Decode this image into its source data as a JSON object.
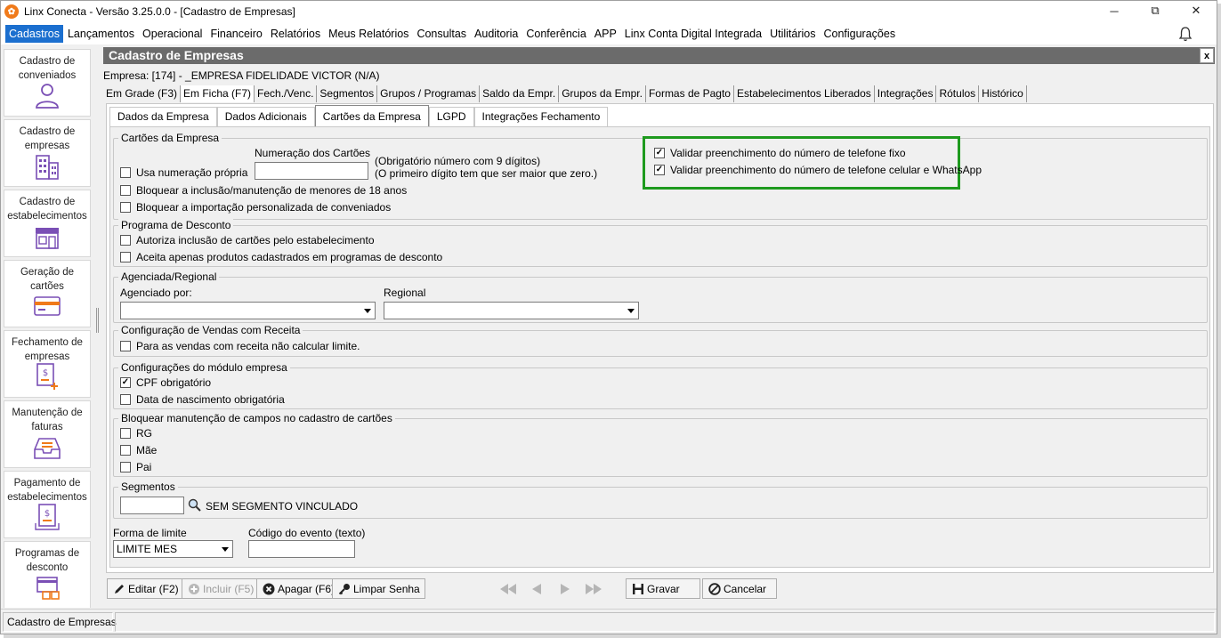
{
  "window": {
    "title": "Linx Conecta - Versão 3.25.0.0 - [Cadastro de Empresas]",
    "minimize": "─",
    "maximize": "⧉",
    "close": "✕"
  },
  "menu": [
    "Cadastros",
    "Lançamentos",
    "Operacional",
    "Financeiro",
    "Relatórios",
    "Meus Relatórios",
    "Consultas",
    "Auditoria",
    "Conferência",
    "APP",
    "Linx Conta Digital Integrada",
    "Utilitários",
    "Configurações"
  ],
  "sidebar": [
    {
      "label": "Cadastro de conveniados",
      "icon": "user-icon"
    },
    {
      "label": "Cadastro de empresas",
      "icon": "building-icon"
    },
    {
      "label": "Cadastro de estabelecimentos",
      "icon": "store-icon"
    },
    {
      "label": "Geração de cartões",
      "icon": "card-icon"
    },
    {
      "label": "Fechamento de empresas",
      "icon": "invoice-add-icon"
    },
    {
      "label": "Manutenção de faturas",
      "icon": "tray-icon"
    },
    {
      "label": "Pagamento de estabelecimentos",
      "icon": "invoice-payment-icon"
    },
    {
      "label": "Programas de desconto",
      "icon": "discount-program-icon"
    }
  ],
  "panel": {
    "title": "Cadastro de Empresas",
    "close": "x",
    "empresa": "Empresa: [174] - _EMPRESA FIDELIDADE VICTOR (N/A)"
  },
  "tabs1": [
    "Em Grade (F3)",
    "Em Ficha (F7)",
    "Fech./Venc.",
    "Segmentos",
    "Grupos / Programas",
    "Saldo da Empr.",
    "Grupos da Empr.",
    "Formas de Pagto",
    "Estabelecimentos Liberados",
    "Integrações",
    "Rótulos",
    "Histórico"
  ],
  "tabs2": [
    "Dados da Empresa",
    "Dados Adicionais",
    "Cartões da Empresa",
    "LGPD",
    "Integrações Fechamento"
  ],
  "cartoes": {
    "group": "Cartões da Empresa",
    "numeracao_label": "Numeração dos Cartões",
    "numeracao_value": "",
    "hint1": "(Obrigatório número com 9 dígitos)",
    "hint2": "(O primeiro dígito tem que ser maior que zero.)",
    "usa_numeracao": "Usa numeração própria",
    "bloquear_menores": "Bloquear a inclusão/manutenção de menores de 18 anos",
    "bloquear_importacao": "Bloquear a importação personalizada de conveniados",
    "validar_fixo": "Validar preenchimento do número de telefone fixo",
    "validar_celular": "Validar preenchimento do número de telefone celular e WhatsApp"
  },
  "desconto": {
    "group": "Programa de Desconto",
    "autoriza": "Autoriza inclusão de cartões pelo estabelecimento",
    "aceita": "Aceita apenas produtos cadastrados em programas de desconto"
  },
  "agenciada": {
    "group": "Agenciada/Regional",
    "agenciado_label": "Agenciado por:",
    "agenciado_value": "",
    "regional_label": "Regional",
    "regional_value": ""
  },
  "vendas": {
    "group": "Configuração de Vendas com Receita",
    "nao_calcular": "Para as vendas com receita não calcular limite."
  },
  "modulo": {
    "group": "Configurações do módulo empresa",
    "cpf": "CPF obrigatório",
    "nascimento": "Data de nascimento obrigatória"
  },
  "bloquear_campos": {
    "group": "Bloquear manutenção de campos no cadastro de cartões",
    "rg": "RG",
    "mae": "Mãe",
    "pai": "Pai"
  },
  "segmentos": {
    "group": "Segmentos",
    "value": "",
    "text": "SEM SEGMENTO VINCULADO"
  },
  "forma_limite": {
    "label": "Forma de limite",
    "value": "LIMITE MES"
  },
  "codigo_evento": {
    "label": "Código do evento (texto)",
    "value": ""
  },
  "toolbar": {
    "editar": "Editar (F2)",
    "incluir": "Incluir (F5)",
    "apagar": "Apagar (F6)",
    "limpar": "Limpar Senha",
    "gravar": "Gravar",
    "cancelar": "Cancelar"
  },
  "status": "Cadastro de Empresas",
  "colors": {
    "accent": "#1b6fcf",
    "header": "#6b6b6b",
    "highlight": "#1e9a1e",
    "orange": "#f07a1a",
    "icon": "#7a4fb5"
  }
}
